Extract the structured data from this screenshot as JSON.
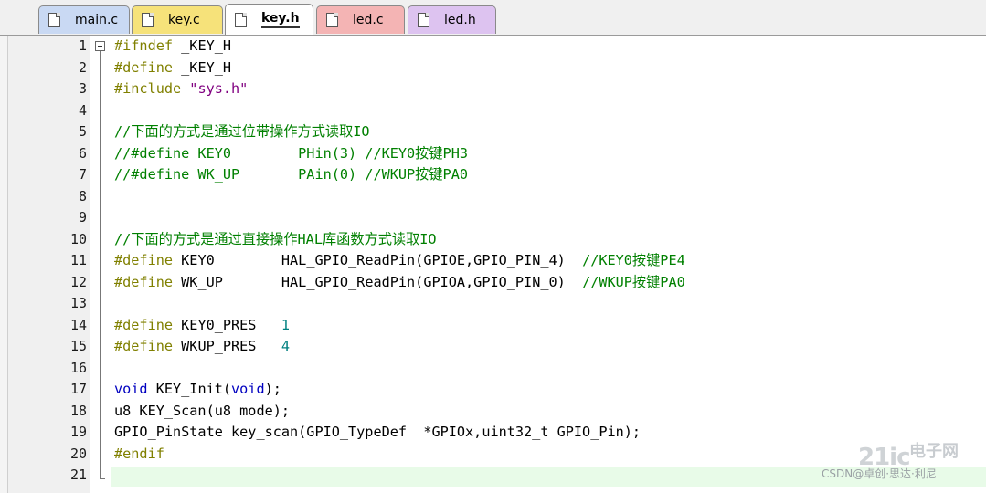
{
  "tabs": [
    {
      "label": "main.c",
      "color": "#c9d9f3",
      "active": false
    },
    {
      "label": "key.c",
      "color": "#f6e27a",
      "active": false
    },
    {
      "label": "key.h",
      "color": "#ffffff",
      "active": true
    },
    {
      "label": "led.c",
      "color": "#f4b4b4",
      "active": false
    },
    {
      "label": "led.h",
      "color": "#ddc3f0",
      "active": false
    }
  ],
  "line_numbers": [
    "1",
    "2",
    "3",
    "4",
    "5",
    "6",
    "7",
    "8",
    "9",
    "10",
    "11",
    "12",
    "13",
    "14",
    "15",
    "16",
    "17",
    "18",
    "19",
    "20",
    "21"
  ],
  "code": {
    "l1_kw": "#ifndef",
    "l1_rest": " _KEY_H",
    "l2_kw": "#define",
    "l2_rest": " _KEY_H",
    "l3_kw": "#include",
    "l3_str": " \"sys.h\"",
    "l5_cmt": "//下面的方式是通过位带操作方式读取IO",
    "l6_cmt": "//#define KEY0        PHin(3) //KEY0按键PH3",
    "l7_cmt": "//#define WK_UP       PAin(0) //WKUP按键PA0",
    "l10_cmt": "//下面的方式是通过直接操作HAL库函数方式读取IO",
    "l11_kw": "#define",
    "l11_rest": " KEY0        HAL_GPIO_ReadPin(GPIOE,GPIO_PIN_4)  ",
    "l11_cmt": "//KEY0按键PE4",
    "l12_kw": "#define",
    "l12_rest": " WK_UP       HAL_GPIO_ReadPin(GPIOA,GPIO_PIN_0)  ",
    "l12_cmt": "//WKUP按键PA0",
    "l14_kw": "#define",
    "l14_rest": " KEY0_PRES   ",
    "l14_num": "1",
    "l15_kw": "#define",
    "l15_rest": " WKUP_PRES   ",
    "l15_num": "4",
    "l17_kw1": "void",
    "l17_mid": " KEY_Init(",
    "l17_kw2": "void",
    "l17_end": ");",
    "l18": "u8 KEY_Scan(u8 mode);",
    "l19": "GPIO_PinState key_scan(GPIO_TypeDef  *GPIOx,uint32_t GPIO_Pin);",
    "l20_kw": "#endif"
  },
  "watermark": {
    "mark": "21ic",
    "mark_cn": "电子网",
    "text": "CSDN@卓创·思达·利尼"
  }
}
